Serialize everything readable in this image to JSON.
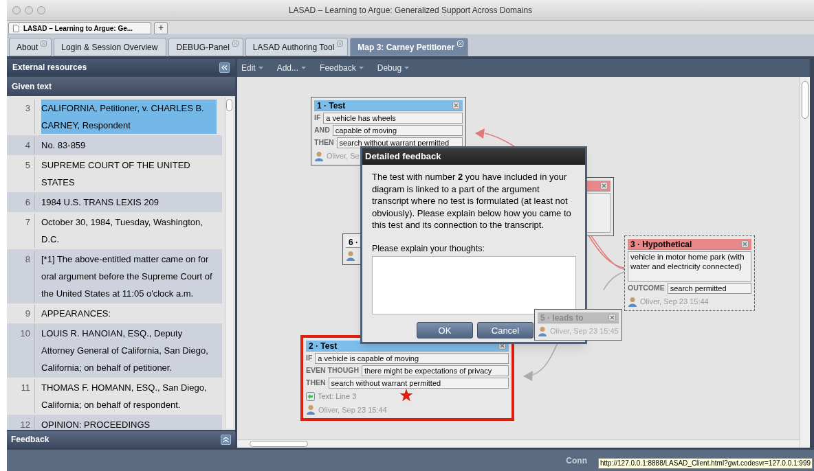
{
  "window": {
    "title": "LASAD – Learning to Argue: Generalized Support Across Domains"
  },
  "browser_tabs": [
    {
      "label": "LASAD – Learning to Argue: Ge...",
      "selected": true
    }
  ],
  "new_tab_button": "+",
  "app_tabs": [
    {
      "label": "About",
      "closable": true,
      "selected": false
    },
    {
      "label": "Login & Session Overview",
      "closable": false,
      "selected": false
    },
    {
      "label": "DEBUG-Panel",
      "closable": true,
      "selected": false
    },
    {
      "label": "LASAD Authoring Tool",
      "closable": true,
      "selected": false
    },
    {
      "label": "Map 3: Carney Petitioner",
      "closable": true,
      "selected": true
    }
  ],
  "left_panel": {
    "title": "External resources",
    "section": "Given text",
    "lines": [
      {
        "number": "3",
        "text": "CALIFORNIA, Petitioner, v. CHARLES B. CARNEY, Respondent",
        "selected": true
      },
      {
        "number": "4",
        "text": "No. 83-859",
        "selected": false
      },
      {
        "number": "5",
        "text": "SUPREME COURT OF THE UNITED STATES",
        "selected": false
      },
      {
        "number": "6",
        "text": "1984 U.S. TRANS LEXIS 209",
        "selected": false
      },
      {
        "number": "7",
        "text": "October 30, 1984, Tuesday, Washington, D.C.",
        "selected": false
      },
      {
        "number": "8",
        "text": "[*1] The above-entitled matter came on for oral argument before the Supreme Court of the United States at 11:05 o'clock a.m.",
        "selected": false
      },
      {
        "number": "9",
        "text": "APPEARANCES:",
        "selected": false
      },
      {
        "number": "10",
        "text": "LOUIS R. HANOIAN, ESQ., Deputy Attorney General of California, San Diego, California; on behalf of petitioner.",
        "selected": false
      },
      {
        "number": "11",
        "text": "THOMAS F. HOMANN, ESQ., San Diego, California; on behalf of respondent.",
        "selected": false
      },
      {
        "number": "12",
        "text": "OPINION: PROCEEDINGS",
        "selected": false
      }
    ]
  },
  "feedback_panel": {
    "title": "Feedback"
  },
  "menu": [
    "Edit",
    "Add...",
    "Feedback",
    "Debug"
  ],
  "nodes": [
    {
      "kind": "box",
      "title": "1 · Test",
      "color": "#7dbde9",
      "highlighted": false,
      "starred": false,
      "fields": [
        {
          "label": "IF",
          "value": "a vehicle has wheels"
        },
        {
          "label": "AND",
          "value": "capable of moving"
        },
        {
          "label": "THEN",
          "value": "search without warrant permitted"
        }
      ],
      "author": "Oliver, Se"
    },
    {
      "kind": "stub",
      "title": "6 ·",
      "color": "#f0f0f0",
      "highlighted": false,
      "starred": false
    },
    {
      "kind": "stub",
      "color": "#e88888",
      "highlighted": false,
      "starred": false
    },
    {
      "kind": "box",
      "title": "3 · Hypothetical",
      "color": "#e88888",
      "highlighted": false,
      "starred": false,
      "dotted": true,
      "text": "vehicle in motor home park (with water and electricity connected)",
      "fields": [
        {
          "label": "OUTCOME",
          "value": "search permitted"
        }
      ],
      "author": "Oliver, Sep 23 15:44"
    },
    {
      "kind": "faded",
      "title": "5 · leads to",
      "color": "#bdbdbd",
      "highlighted": false,
      "starred": false,
      "author": "Oliver, Sep 23 15:45"
    },
    {
      "kind": "box",
      "title": "2 · Test",
      "color": "#7dbde9",
      "highlighted": true,
      "starred": true,
      "fields": [
        {
          "label": "IF",
          "value": "a vehicle is capable of moving"
        },
        {
          "label": "EVEN THOUGH",
          "value": "there might be expectations of privacy"
        },
        {
          "label": "THEN",
          "value": "search without warrant permitted"
        }
      ],
      "source": "Text: Line 3",
      "author": "Oliver, Sep 23 15:44"
    }
  ],
  "dialog": {
    "title": "Detailed feedback",
    "message": "The test with number **2** you have included in your diagram is linked to a part of the argument transcript where no test is formulated (at least not obviously). Please explain below how you came to this test and its connection to the transcript.",
    "prompt": "Please explain your thoughts:",
    "buttons": [
      "OK",
      "Cancel"
    ]
  },
  "status_bar": {
    "text": "Conn",
    "tooltip": "http://127.0.0.1:8888/LASAD_Client.html?gwt.codesvr=127.0.0.1:999"
  }
}
